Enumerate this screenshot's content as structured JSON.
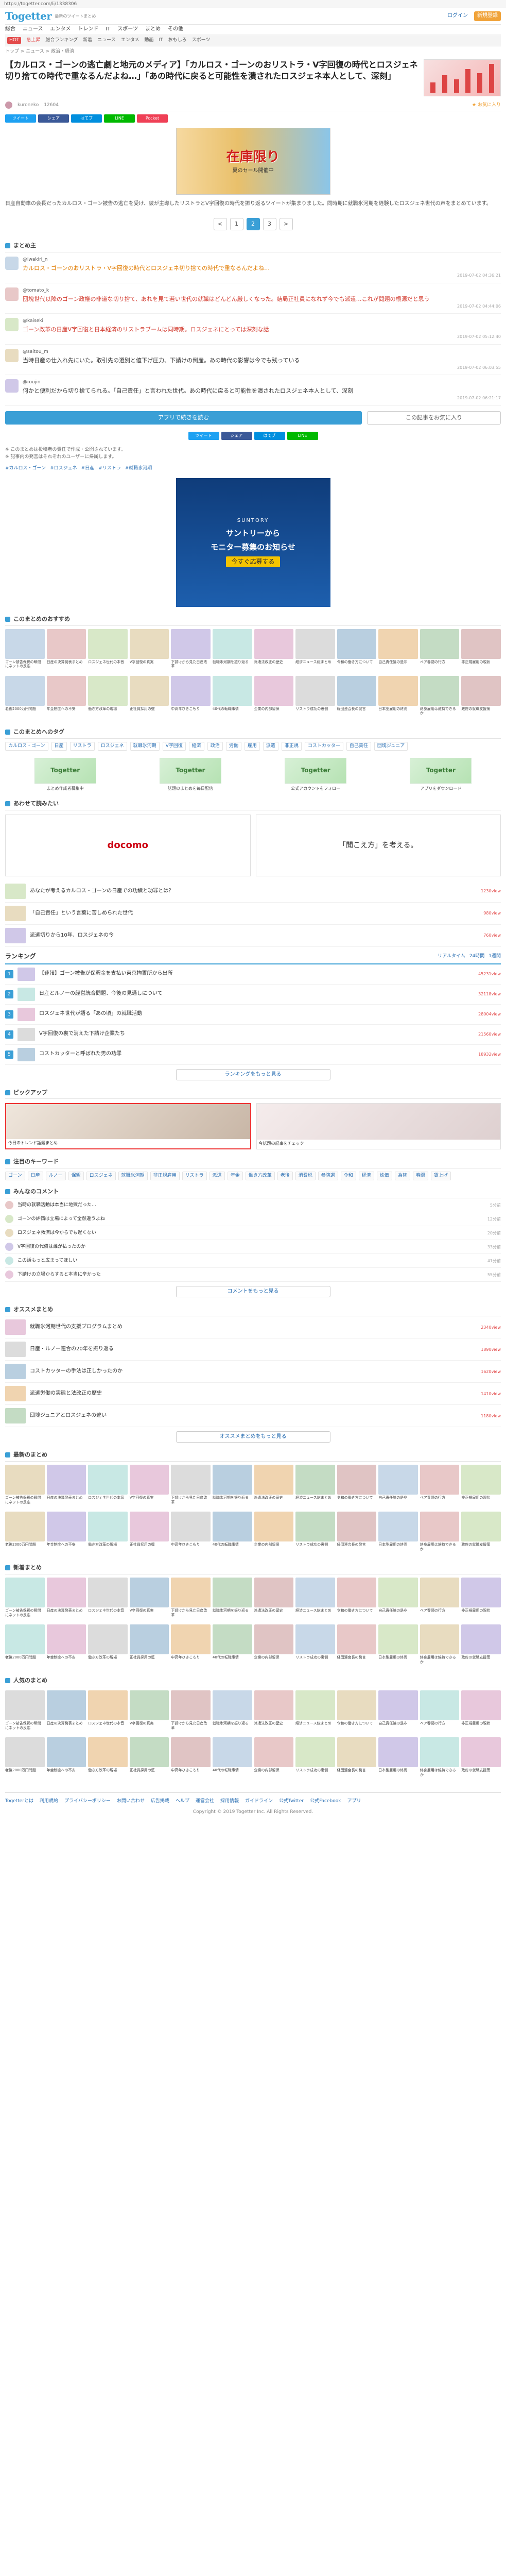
{
  "browser": {
    "url": "https://togetter.com/li/1338306"
  },
  "header": {
    "logo": "Togetter",
    "tagline": "最新のツイートまとめ",
    "login": "ログイン",
    "signup": "新規登録",
    "nav": [
      "総合",
      "ニュース",
      "エンタメ",
      "トレンド",
      "IT",
      "スポーツ",
      "まとめ",
      "その他"
    ],
    "subnav": [
      "HOT",
      "急上昇",
      "総合ランキング",
      "新着",
      "ニュース",
      "エンタメ",
      "動画",
      "IT",
      "おもしろ",
      "スポーツ"
    ]
  },
  "breadcrumb": "トップ > ニュース > 政治・経済",
  "article": {
    "title": "【カルロス・ゴーンの逃亡劇と地元のメディア】「カルロス・ゴーンのおリストラ・V字回復の時代とロスジェネ切り捨ての時代で重なるんだよね…」「あの時代に戻ると可能性を潰されたロスジェネ本人として、深刻」",
    "author": "kuroneko",
    "views": "12604",
    "fav_label": "お気に入り",
    "share": [
      "ツイート",
      "シェア",
      "はてブ",
      "LINE",
      "Pocket"
    ],
    "ad_text": "在庫限り",
    "ad_sub": "夏のセール開催中",
    "description": "日産自動車の会長だったカルロス・ゴーン被告の逃亡を受け、彼が主導したリストラとV字回復の時代を振り返るツイートが集まりました。同時期に就職氷河期を経験したロスジェネ世代の声をまとめています。"
  },
  "pager": [
    "<",
    "1",
    "2",
    "3",
    ">"
  ],
  "tweets_section_title": "まとめ主",
  "tweets": [
    {
      "name": "@iwakiri_n",
      "text": "カルロス・ゴーンのおリストラ・V字回復の時代とロスジェネ切り捨ての時代で重なるんだよね…",
      "style": "hl",
      "date": "2019-07-02 04:36:21"
    },
    {
      "name": "@tomato_k",
      "text": "団塊世代以降のゴーン政権の非道な切り捨て、あれを見て若い世代の就職はどんどん厳しくなった。結局正社員になれず今でも派遣…これが問題の根源だと思う",
      "style": "red",
      "date": "2019-07-02 04:44:06"
    },
    {
      "name": "@kaiseki",
      "text": "ゴーン改革の日産V字回復と日本経済のリストラブームは同時期。ロスジェネにとっては深刻な話",
      "style": "red",
      "date": "2019-07-02 05:12:40"
    },
    {
      "name": "@saitou_m",
      "text": "当時日産の仕入れ先にいた。取引先の選別と値下げ圧力、下請けの倒産。あの時代の影響は今でも残っている",
      "style": "",
      "date": "2019-07-02 06:03:55"
    },
    {
      "name": "@roujin",
      "text": "何かと便利だから切り捨てられる。「自己責任」と言われた世代。あの時代に戻ると可能性を潰されたロスジェネ本人として、深刻",
      "style": "",
      "date": "2019-07-02 06:21:17"
    }
  ],
  "more_button": "アプリで続きを読む",
  "fav_button": "この記事をお気に入り",
  "notes": [
    "※ このまとめは投稿者の責任で作成・公開されています。",
    "※ 記事内の発言はそれぞれのユーザーに帰属します。"
  ],
  "links": [
    "#カルロス・ゴーン",
    "#ロスジェネ",
    "#日産",
    "#リストラ",
    "#就職氷河期"
  ],
  "big_ad": {
    "brand": "SUNTORY",
    "line1": "サントリーから",
    "line2": "モニター募集のお知らせ",
    "line3": "今すぐ応募する"
  },
  "section_related": "このまとめのおすすめ",
  "related_cards": [
    "ゴーン被告保釈の瞬間にネットの反応",
    "日産の決算発表まとめ",
    "ロスジェネ世代の本音",
    "V字回復の真実",
    "下請けから見た日産改革",
    "就職氷河期を振り返る",
    "派遣法改正の歴史",
    "経済ニュース総まとめ",
    "令和の働き方について",
    "自己責任論の是非",
    "ベア春闘の行方",
    "非正規雇用の現状",
    "老後2000万円問題",
    "年金制度への不安",
    "働き方改革の現場",
    "正社員採用の壁",
    "中高年ひきこもり",
    "40代の転職事情",
    "企業の内部留保",
    "リストラ成功の裏側",
    "経団連会長の発言",
    "日本型雇用の終焉",
    "終身雇用は維持できるか",
    "政府の就職支援策"
  ],
  "tagcloud_title": "このまとめへのタグ",
  "tags": [
    "カルロス・ゴーン",
    "日産",
    "リストラ",
    "ロスジェネ",
    "就職氷河期",
    "V字回復",
    "経済",
    "政治",
    "労働",
    "雇用",
    "派遣",
    "非正規",
    "コストカッター",
    "自己責任",
    "団塊ジュニア"
  ],
  "promos": [
    {
      "logo": "Togetter",
      "cap": "まとめ作成者募集中"
    },
    {
      "logo": "Togetter",
      "cap": "話題のまとめを毎日配信"
    },
    {
      "logo": "Togetter",
      "cap": "公式アカウントをフォロー"
    },
    {
      "logo": "Togetter",
      "cap": "アプリをダウンロード"
    }
  ],
  "section_recommend": "あわせて読みたい",
  "ad2": {
    "left": "docomo",
    "right": "「聞こえ方」を考える。"
  },
  "mini_list": [
    {
      "text": "あなたが考えるカルロス・ゴーンの日産での功績と功罪とは？",
      "cnt": "1230view"
    },
    {
      "text": "「自己責任」という言葉に苦しめられた世代",
      "cnt": "980view"
    },
    {
      "text": "派遣切りから10年、ロスジェネの今",
      "cnt": "760view"
    }
  ],
  "ranking": {
    "title": "ランキング",
    "tabs": [
      "リアルタイム",
      "24時間",
      "1週間"
    ],
    "items": [
      {
        "text": "【速報】ゴーン被告が保釈金を支払い東京拘置所から出所",
        "cnt": "45231view"
      },
      {
        "text": "日産とルノーの経営統合問題、今後の見通しについて",
        "cnt": "32118view"
      },
      {
        "text": "ロスジェネ世代が語る「あの頃」の就職活動",
        "cnt": "28004view"
      },
      {
        "text": "V字回復の裏で消えた下請け企業たち",
        "cnt": "21560view"
      },
      {
        "text": "コストカッターと呼ばれた男の功罪",
        "cnt": "18932view"
      }
    ],
    "more": "ランキングをもっと見る"
  },
  "pickup_title": "ピックアップ",
  "pickups": [
    "今日のトレンド話題まとめ",
    "今話題の記事をチェック"
  ],
  "keywords_title": "注目のキーワード",
  "keywords": [
    "ゴーン",
    "日産",
    "ルノー",
    "保釈",
    "ロスジェネ",
    "就職氷河期",
    "非正規雇用",
    "リストラ",
    "派遣",
    "年金",
    "働き方改革",
    "老後",
    "消費税",
    "参院選",
    "令和",
    "経済",
    "株価",
    "為替",
    "春闘",
    "賃上げ"
  ],
  "comments_title": "みんなのコメント",
  "comments": [
    {
      "text": "当時の就職活動は本当に地獄だった…",
      "time": "5分前"
    },
    {
      "text": "ゴーンの評価は立場によって全然違うよね",
      "time": "12分前"
    },
    {
      "text": "ロスジェネ救済は今からでも遅くない",
      "time": "20分前"
    },
    {
      "text": "V字回復の代償は誰が払ったのか",
      "time": "33分前"
    },
    {
      "text": "この話もっと広まってほしい",
      "time": "41分前"
    },
    {
      "text": "下請けの立場からすると本当に辛かった",
      "time": "55分前"
    }
  ],
  "comments_more": "コメントをもっと見る",
  "osusume_title": "オススメまとめ",
  "osusume": [
    {
      "text": "就職氷河期世代の支援プログラムまとめ",
      "cnt": "2340view"
    },
    {
      "text": "日産・ルノー連合の20年を振り返る",
      "cnt": "1890view"
    },
    {
      "text": "コストカッターの手法は正しかったのか",
      "cnt": "1620view"
    },
    {
      "text": "派遣労働の実態と法改正の歴史",
      "cnt": "1410view"
    },
    {
      "text": "団塊ジュニアとロスジェネの違い",
      "cnt": "1180view"
    }
  ],
  "osusume_more": "オススメまとめをもっと見る",
  "section_news": "最新のまとめ",
  "section_new2": "新着まとめ",
  "section_new3": "人気のまとめ",
  "footer": {
    "links": [
      "Togetterとは",
      "利用規約",
      "プライバシーポリシー",
      "お問い合わせ",
      "広告掲載",
      "ヘルプ",
      "運営会社",
      "採用情報",
      "ガイドライン",
      "公式Twitter",
      "公式Facebook",
      "アプリ"
    ],
    "copyright": "Copyright © 2019 Togetter Inc. All Rights Reserved."
  },
  "colors": {
    "accent": "#3a9fd6",
    "orange": "#f0a33a",
    "red": "#e34b4b"
  }
}
